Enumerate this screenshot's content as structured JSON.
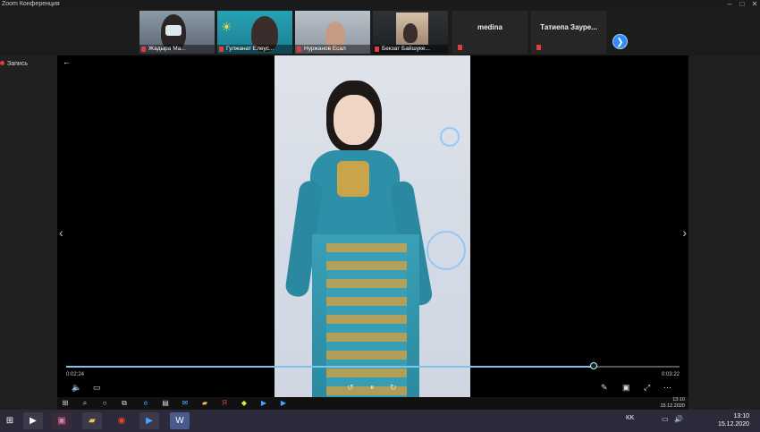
{
  "window": {
    "title": "Zoom Конференция"
  },
  "participants": [
    {
      "name": "Жадыра Ма..."
    },
    {
      "name": "Гулжанат Елеус..."
    },
    {
      "name": "Нуржанов Есал"
    },
    {
      "name": "Бекзат Байшукe..."
    }
  ],
  "text_participants": [
    {
      "name": "medina"
    },
    {
      "name": "Татиепа Зауре..."
    }
  ],
  "recording": {
    "label": "Запись"
  },
  "player": {
    "current_time": "0:02:24",
    "total_time": "0:03:22",
    "progress": 0.86
  },
  "inner_clock": {
    "time": "13:10",
    "date": "15.12.2020"
  },
  "taskbar": {
    "lang": "KK",
    "time": "13:10",
    "date": "15.12.2020"
  },
  "colors": {
    "accent": "#2d8cff",
    "progress": "#7ec4e6",
    "record": "#e23c3c"
  }
}
